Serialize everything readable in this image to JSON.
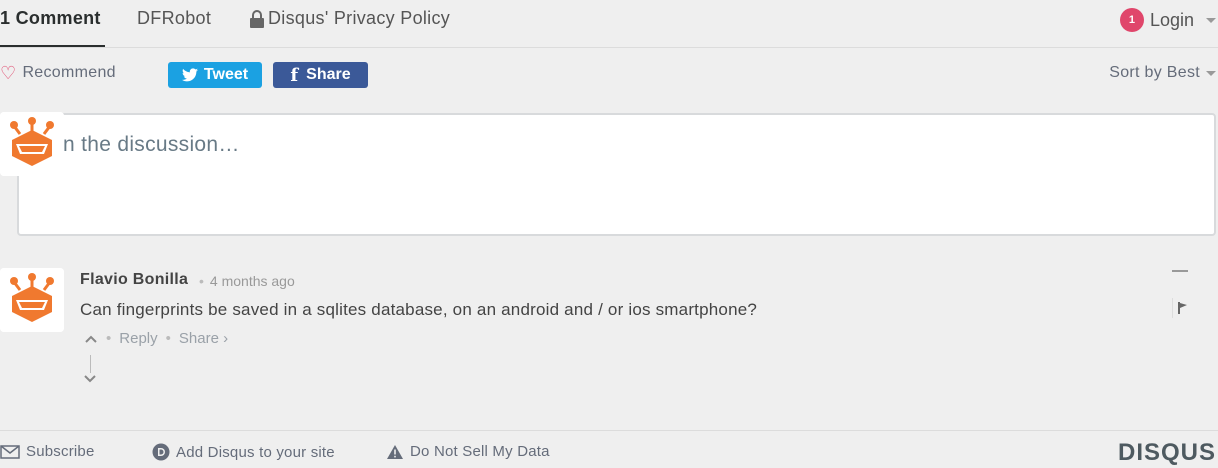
{
  "nav": {
    "count_tab": "1 Comment",
    "site_tab": "DFRobot",
    "privacy_tab": "Disqus' Privacy Policy",
    "notifications": "1",
    "login": "Login"
  },
  "actions": {
    "recommend": "Recommend",
    "tweet": "Tweet",
    "share": "Share",
    "sort": "Sort by Best"
  },
  "composer": {
    "placeholder": "n the discussion…"
  },
  "post": {
    "author": "Flavio Bonilla",
    "time": "4 months ago",
    "text": "Can fingerprints be saved in a sqlites database, on an android and / or ios smartphone?",
    "reply": "Reply",
    "share": "Share ›"
  },
  "bottom": {
    "subscribe": "Subscribe",
    "add_disqus": "Add Disqus to your site",
    "do_not_sell": "Do Not Sell My Data",
    "logo": "DISQUS"
  },
  "colors": {
    "tweet": "#1ba1e2",
    "facebook": "#3b5998",
    "badge": "#e0466b",
    "avatar_orange": "#f0792f"
  }
}
